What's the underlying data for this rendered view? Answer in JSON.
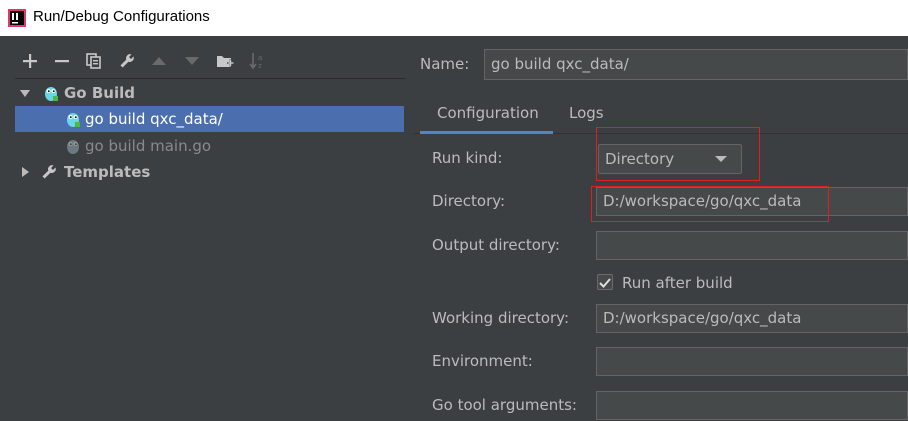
{
  "window": {
    "title": "Run/Debug Configurations",
    "app_icon": "intellij-icon"
  },
  "toolbar": {
    "buttons": [
      "add-icon",
      "remove-icon",
      "copy-icon",
      "wrench-icon",
      "move-up-icon",
      "move-down-icon",
      "new-folder-icon",
      "sort-icon"
    ]
  },
  "tree": {
    "group": {
      "label": "Go Build",
      "icon": "gopher-icon",
      "expanded": true
    },
    "items": [
      {
        "label": "go build qxc_data/",
        "selected": true
      },
      {
        "label": "go build main.go",
        "selected": false
      }
    ],
    "templates": {
      "label": "Templates",
      "icon": "wrench-icon",
      "expanded": false
    }
  },
  "form": {
    "name_label": "Name:",
    "name_value": "go build qxc_data/",
    "tabs": [
      {
        "label": "Configuration",
        "active": true
      },
      {
        "label": "Logs",
        "active": false
      }
    ],
    "run_kind_label": "Run kind:",
    "run_kind_value": "Directory",
    "directory_label": "Directory:",
    "directory_value": "D:/workspace/go/qxc_data",
    "output_directory_label": "Output directory:",
    "output_directory_value": "",
    "run_after_build_label": "Run after build",
    "run_after_build_checked": true,
    "working_directory_label": "Working directory:",
    "working_directory_value": "D:/workspace/go/qxc_data",
    "environment_label": "Environment:",
    "environment_value": "",
    "go_tool_arguments_label": "Go tool arguments:",
    "go_tool_arguments_value": ""
  },
  "colors": {
    "background": "#3c3f41",
    "selection": "#4b6eaf",
    "field": "#45494a",
    "tab_underline": "#4a88c7",
    "annotation_red": "#e02020"
  }
}
